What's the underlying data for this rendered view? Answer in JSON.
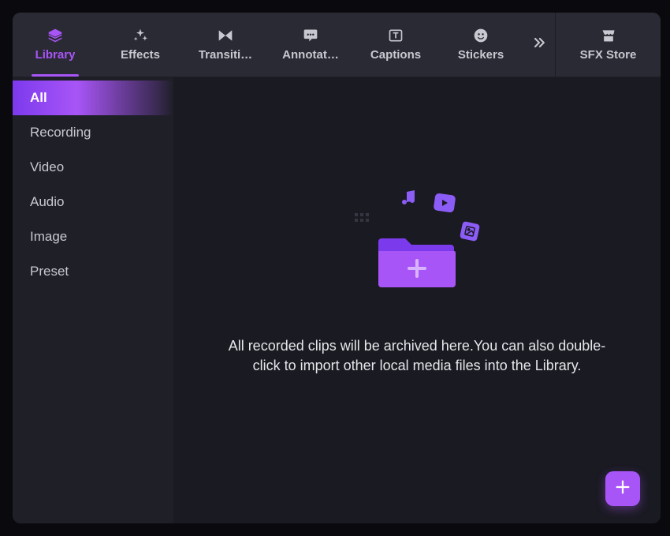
{
  "tabs": {
    "library": "Library",
    "effects": "Effects",
    "transitions": "Transiti…",
    "annotations": "Annotat…",
    "captions": "Captions",
    "stickers": "Stickers",
    "sfx_store": "SFX Store"
  },
  "sidebar": {
    "items": [
      {
        "label": "All",
        "active": true
      },
      {
        "label": "Recording",
        "active": false
      },
      {
        "label": "Video",
        "active": false
      },
      {
        "label": "Audio",
        "active": false
      },
      {
        "label": "Image",
        "active": false
      },
      {
        "label": "Preset",
        "active": false
      }
    ]
  },
  "empty_state": {
    "text": "All recorded clips will be archived here.You can also double-click to import other local media files into the Library."
  },
  "colors": {
    "accent": "#a855f7",
    "bg_panel": "#1a1a22",
    "bg_tabs": "#2a2a34"
  }
}
